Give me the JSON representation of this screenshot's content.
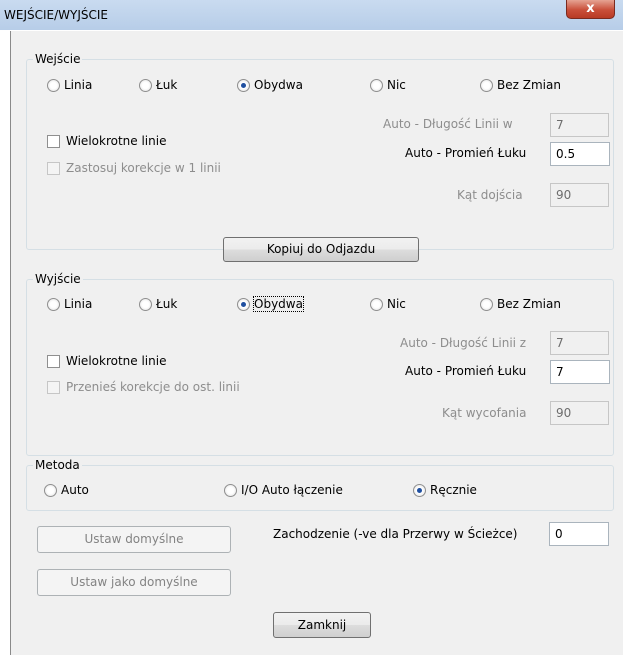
{
  "window": {
    "title": "WEJŚCIE/WYJŚCIE",
    "close_glyph": "x"
  },
  "entry": {
    "group_label": "Wejście",
    "radios": [
      "Linia",
      "Łuk",
      "Obydwa",
      "Nic",
      "Bez Zmian"
    ],
    "selected": "Obydwa",
    "multiple_lines": "Wielokrotne linie",
    "apply_correction": "Zastosuj korekcje w 1 linii",
    "auto_line_length_label": "Auto - Długość Linii w",
    "auto_line_length_value": "7",
    "auto_arc_radius_label": "Auto - Promień Łuku",
    "auto_arc_radius_value": "0.5",
    "angle_label": "Kąt dojścia",
    "angle_value": "90"
  },
  "copy_button": "Kopiuj do Odjazdu",
  "exit": {
    "group_label": "Wyjście",
    "radios": [
      "Linia",
      "Łuk",
      "Obydwa",
      "Nic",
      "Bez Zmian"
    ],
    "selected": "Obydwa",
    "multiple_lines": "Wielokrotne linie",
    "move_correction": "Przenieś korekcje do ost. linii",
    "auto_line_length_label": "Auto - Długość Linii z",
    "auto_line_length_value": "7",
    "auto_arc_radius_label": "Auto - Promień Łuku",
    "auto_arc_radius_value": "7",
    "angle_label": "Kąt wycofania",
    "angle_value": "90"
  },
  "method": {
    "group_label": "Metoda",
    "options": [
      "Auto",
      "I/O Auto łączenie",
      "Ręcznie"
    ],
    "selected": "Ręcznie"
  },
  "buttons": {
    "set_defaults": "Ustaw domyślne",
    "set_as_default": "Ustaw jako domyślne",
    "close": "Zamknij"
  },
  "overlap": {
    "label": "Zachodzenie (-ve dla Przerwy w Ścieżce)",
    "value": "0"
  }
}
